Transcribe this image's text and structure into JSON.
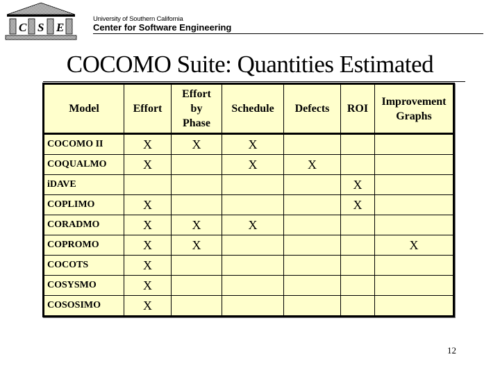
{
  "header": {
    "logo_letters": [
      "C",
      "S",
      "E"
    ],
    "university": "University of Southern California",
    "center": "Center for Software  Engineering"
  },
  "title": "COCOMO Suite: Quantities Estimated",
  "table": {
    "columns": [
      "Model",
      "Effort",
      "Effort by Phase",
      "Schedule",
      "Defects",
      "ROI",
      "Improvement Graphs"
    ],
    "header_lines": [
      [
        "Model"
      ],
      [
        "Effort"
      ],
      [
        "Effort",
        "by",
        "Phase"
      ],
      [
        "Schedule"
      ],
      [
        "Defects"
      ],
      [
        "ROI"
      ],
      [
        "Improvement",
        "Graphs"
      ]
    ],
    "rows": [
      {
        "model": "COCOMO II",
        "cells": [
          "X",
          "X",
          "X",
          "",
          "",
          ""
        ]
      },
      {
        "model": "COQUALMO",
        "cells": [
          "X",
          "",
          "X",
          "X",
          "",
          ""
        ]
      },
      {
        "model": "iDAVE",
        "cells": [
          "",
          "",
          "",
          "",
          "X",
          ""
        ]
      },
      {
        "model": "COPLIMO",
        "cells": [
          "X",
          "",
          "",
          "",
          "X",
          ""
        ]
      },
      {
        "model": "CORADMO",
        "cells": [
          "X",
          "X",
          "X",
          "",
          "",
          ""
        ]
      },
      {
        "model": "COPROMO",
        "cells": [
          "X",
          "X",
          "",
          "",
          "",
          "X"
        ]
      },
      {
        "model": "COCOTS",
        "cells": [
          "X",
          "",
          "",
          "",
          "",
          ""
        ]
      },
      {
        "model": "COSYSMO",
        "cells": [
          "X",
          "",
          "",
          "",
          "",
          ""
        ]
      },
      {
        "model": "COSOSIMO",
        "cells": [
          "X",
          "",
          "",
          "",
          "",
          ""
        ]
      }
    ]
  },
  "page_number": "12",
  "colors": {
    "table_fill": "#ffffcc",
    "text": "#000000"
  }
}
